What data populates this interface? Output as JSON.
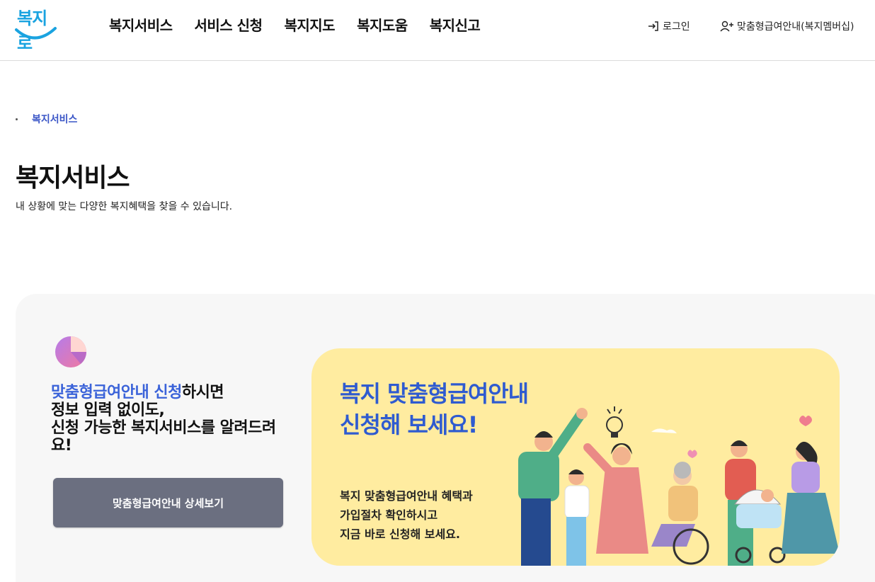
{
  "header": {
    "logo_text": "복지로",
    "nav": [
      "복지서비스",
      "서비스 신청",
      "복지지도",
      "복지도움",
      "복지신고"
    ],
    "login_label": "로그인",
    "member_label": "맞춤형급여안내(복지멤버십)"
  },
  "breadcrumb": {
    "current": "복지서비스"
  },
  "page": {
    "title": "복지서비스",
    "description": "내 상황에 맞는 다양한 복지혜택을 찾을 수 있습니다."
  },
  "promo": {
    "highlight": "맞춤형급여안내 신청",
    "line1_rest": "하시면",
    "line2": "정보 입력 없이도,",
    "line3": "신청 가능한 복지서비스를 알려드려요!",
    "button_label": "맞춤형급여안내 상세보기"
  },
  "card": {
    "title_line1": "복지 맞춤형급여안내",
    "title_line2": "신청해 보세요!",
    "body_line1": "복지 맞춤형급여안내 혜택과",
    "body_line2": "가입절차 확인하시고",
    "body_line3": "지금 바로 신청해 보세요."
  },
  "icons": {
    "logo": "boksiro-logo",
    "login": "login-arrow-icon",
    "member": "user-plus-icon",
    "chart": "pie-chart-icon"
  },
  "colors": {
    "accent": "#3b63d9",
    "button": "#6b6f80",
    "card": "#ffeca0",
    "panel": "#f7f7f7"
  }
}
